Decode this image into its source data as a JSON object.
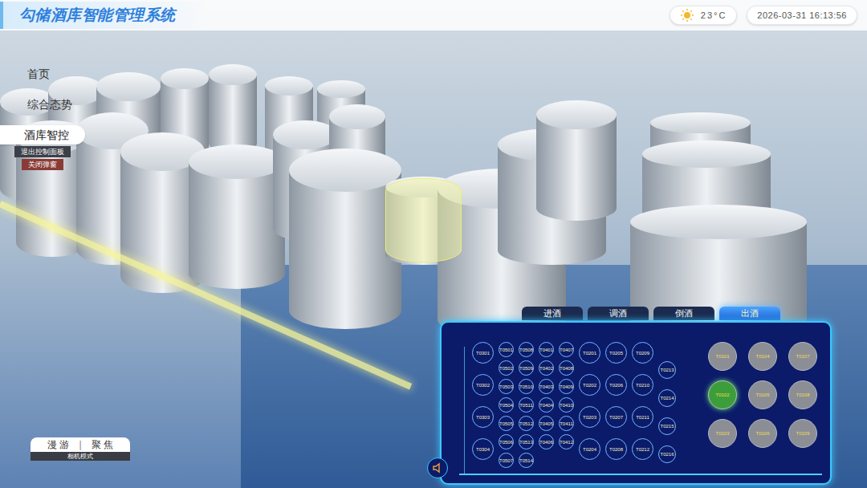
{
  "header": {
    "title": "勾储酒库智能管理系统",
    "weather": "23°C",
    "datetime": "2026-03-31 16:13:56"
  },
  "nav": {
    "items": [
      {
        "label": "首页",
        "selected": false
      },
      {
        "label": "综合态势",
        "selected": false
      },
      {
        "label": "酒库智控",
        "selected": true
      }
    ],
    "subitems": [
      {
        "label": "退出控制面板",
        "color": "#3a3f48"
      },
      {
        "label": "关闭弹窗",
        "color": "#8a3b36"
      }
    ]
  },
  "camera": {
    "modes": [
      "漫 游",
      "聚 焦"
    ],
    "separator": "|",
    "caption": "相机模式"
  },
  "panel": {
    "tabs": [
      {
        "label": "进酒",
        "selected": false
      },
      {
        "label": "调酒",
        "selected": false
      },
      {
        "label": "倒酒",
        "selected": false
      },
      {
        "label": "出酒",
        "selected": true
      }
    ],
    "columns": [
      {
        "kind": "large",
        "tanks": [
          "T0301",
          "T0302",
          "T0303",
          "T0304"
        ]
      },
      {
        "kind": "small",
        "tanks": [
          "T0501",
          "T0502",
          "T0503",
          "T0504",
          "T0505",
          "T0506",
          "T0507"
        ]
      },
      {
        "kind": "small",
        "tanks": [
          "T0508",
          "T0509",
          "T0510",
          "T0511",
          "T0512",
          "T0513",
          "T0514"
        ]
      },
      {
        "kind": "small",
        "tanks": [
          "T0401",
          "T0402",
          "T0403",
          "T0404",
          "T0405",
          "T0406"
        ]
      },
      {
        "kind": "small",
        "tanks": [
          "T0407",
          "T0408",
          "T0409",
          "T0410",
          "T0411",
          "T0412"
        ]
      },
      {
        "kind": "large",
        "tanks": [
          "T0201",
          "T0202",
          "T0203",
          "T0204"
        ]
      },
      {
        "kind": "large",
        "tanks": [
          "T0205",
          "T0206",
          "T0207",
          "T0208"
        ]
      },
      {
        "kind": "large",
        "tanks": [
          "T0209",
          "T0210",
          "T0211",
          "T0212"
        ]
      },
      {
        "kind": "medium",
        "tanks": [
          "T0213",
          "T0214",
          "T0215",
          "T0216"
        ]
      }
    ],
    "outlet_tanks": [
      {
        "label": "T0101",
        "selected": false,
        "color": "#8c8e96"
      },
      {
        "label": "T0104",
        "selected": false,
        "color": "#8c8e96"
      },
      {
        "label": "T0107",
        "selected": false,
        "color": "#8c8e96"
      },
      {
        "label": "T0102",
        "selected": true,
        "color": "#3c9e3a"
      },
      {
        "label": "T0105",
        "selected": false,
        "color": "#8c8e96"
      },
      {
        "label": "T0108",
        "selected": false,
        "color": "#8c8e96"
      },
      {
        "label": "T0103",
        "selected": false,
        "color": "#8c8e96"
      },
      {
        "label": "T0106",
        "selected": false,
        "color": "#8c8e96"
      },
      {
        "label": "T0109",
        "selected": false,
        "color": "#8c8e96"
      }
    ]
  }
}
